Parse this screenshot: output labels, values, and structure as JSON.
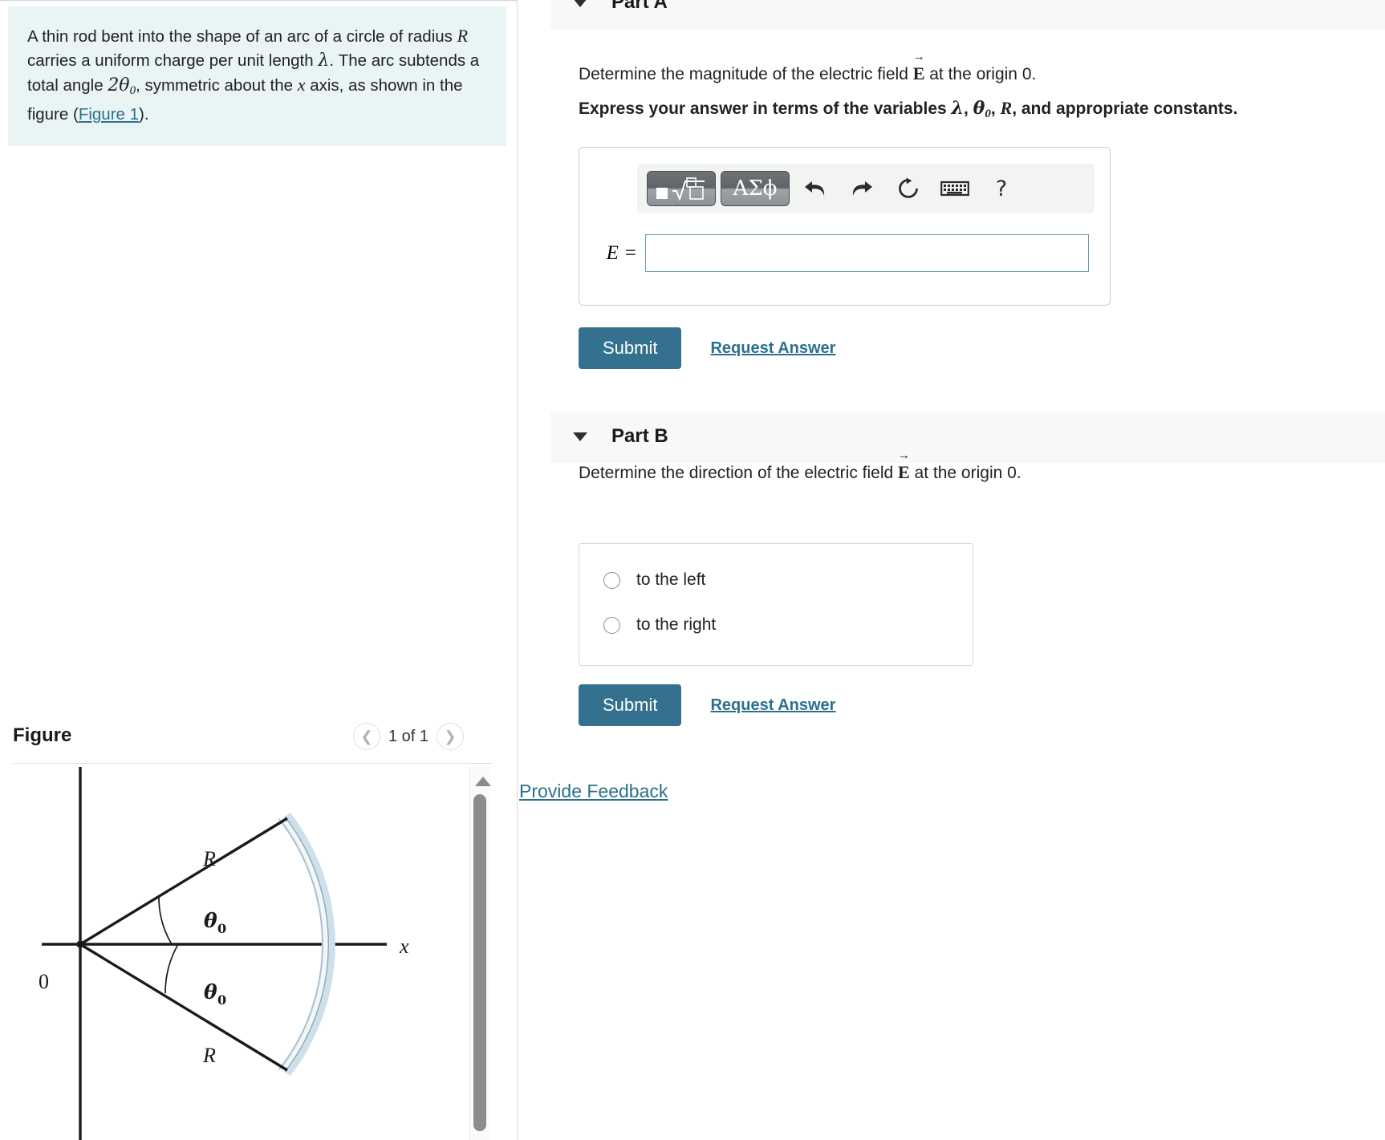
{
  "problem": {
    "text_part1": "A thin rod bent into the shape of an arc of a circle of radius ",
    "var_R": "R",
    "text_part2": " carries a uniform charge per unit length ",
    "var_lambda": "λ",
    "text_part3": ". The arc subtends a total angle ",
    "var_2theta": "2θ",
    "var_2theta_sub": "0",
    "text_part4": ", symmetric about the ",
    "var_x": "x",
    "text_part5": " axis, as shown in the figure (",
    "figure_link": "Figure 1",
    "text_part6": ").",
    "background_color": "#e9f4f5"
  },
  "figure_panel": {
    "title": "Figure",
    "counter": "1 of 1",
    "prev_icon": "chevron-left-icon",
    "next_icon": "chevron-right-icon",
    "scroll_up_icon": "triangle-up-icon",
    "diagram": {
      "origin_label": "0",
      "axis_label_x": "x",
      "radius_label_top": "R",
      "radius_label_bottom": "R",
      "angle_label_top": "θ",
      "angle_label_top_sub": "0",
      "angle_label_bottom": "θ",
      "angle_label_bottom_sub": "0",
      "arc_color": "#c3d7e2",
      "arc_highlight": "#eaf2f7"
    }
  },
  "parts": {
    "part_a": {
      "label": "Part A",
      "caret_icon": "caret-down-icon",
      "question_pre": "Determine the magnitude of the electric field ",
      "question_vector": "E",
      "question_post": " at the origin 0.",
      "instruction_pre": "Express your answer in terms of the variables ",
      "instruction_v1": "λ",
      "instruction_sep1": ", ",
      "instruction_v2": "θ",
      "instruction_v2_sub": "0",
      "instruction_sep2": ", ",
      "instruction_v3": "R",
      "instruction_post": ", and appropriate constants.",
      "toolbar": {
        "template_button": "template-math-icon",
        "greek_button": "ΑΣϕ",
        "undo_icon": "↰",
        "redo_icon": "↱",
        "reset_icon": "↻",
        "keyboard_icon": "keyboard-icon",
        "help_icon": "?"
      },
      "equation_lhs": "E =",
      "input_value": "",
      "input_placeholder": "",
      "submit_label": "Submit",
      "request_answer_label": "Request Answer"
    },
    "part_b": {
      "label": "Part B",
      "caret_icon": "caret-down-icon",
      "question_pre": "Determine the direction of the electric field ",
      "question_vector": "E",
      "question_post": " at the origin 0.",
      "options": [
        {
          "label": "to the left",
          "selected": false
        },
        {
          "label": "to the right",
          "selected": false
        }
      ],
      "submit_label": "Submit",
      "request_answer_label": "Request Answer"
    }
  },
  "footer": {
    "provide_feedback_label": "Provide Feedback"
  },
  "colors": {
    "accent": "#34718f",
    "link": "#2b6f8c",
    "panel_bg": "#f7f8f8",
    "problem_bg": "#e9f4f5"
  }
}
